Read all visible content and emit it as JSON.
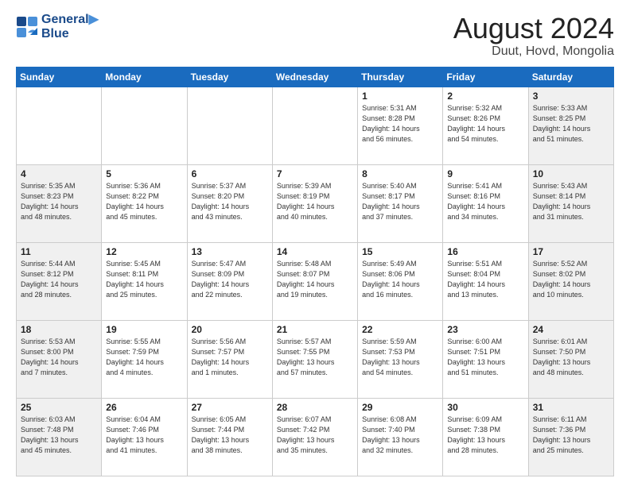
{
  "header": {
    "logo_line1": "General",
    "logo_line2": "Blue",
    "month": "August 2024",
    "location": "Duut, Hovd, Mongolia"
  },
  "weekdays": [
    "Sunday",
    "Monday",
    "Tuesday",
    "Wednesday",
    "Thursday",
    "Friday",
    "Saturday"
  ],
  "weeks": [
    [
      {
        "day": "",
        "info": ""
      },
      {
        "day": "",
        "info": ""
      },
      {
        "day": "",
        "info": ""
      },
      {
        "day": "",
        "info": ""
      },
      {
        "day": "1",
        "info": "Sunrise: 5:31 AM\nSunset: 8:28 PM\nDaylight: 14 hours\nand 56 minutes."
      },
      {
        "day": "2",
        "info": "Sunrise: 5:32 AM\nSunset: 8:26 PM\nDaylight: 14 hours\nand 54 minutes."
      },
      {
        "day": "3",
        "info": "Sunrise: 5:33 AM\nSunset: 8:25 PM\nDaylight: 14 hours\nand 51 minutes."
      }
    ],
    [
      {
        "day": "4",
        "info": "Sunrise: 5:35 AM\nSunset: 8:23 PM\nDaylight: 14 hours\nand 48 minutes."
      },
      {
        "day": "5",
        "info": "Sunrise: 5:36 AM\nSunset: 8:22 PM\nDaylight: 14 hours\nand 45 minutes."
      },
      {
        "day": "6",
        "info": "Sunrise: 5:37 AM\nSunset: 8:20 PM\nDaylight: 14 hours\nand 43 minutes."
      },
      {
        "day": "7",
        "info": "Sunrise: 5:39 AM\nSunset: 8:19 PM\nDaylight: 14 hours\nand 40 minutes."
      },
      {
        "day": "8",
        "info": "Sunrise: 5:40 AM\nSunset: 8:17 PM\nDaylight: 14 hours\nand 37 minutes."
      },
      {
        "day": "9",
        "info": "Sunrise: 5:41 AM\nSunset: 8:16 PM\nDaylight: 14 hours\nand 34 minutes."
      },
      {
        "day": "10",
        "info": "Sunrise: 5:43 AM\nSunset: 8:14 PM\nDaylight: 14 hours\nand 31 minutes."
      }
    ],
    [
      {
        "day": "11",
        "info": "Sunrise: 5:44 AM\nSunset: 8:12 PM\nDaylight: 14 hours\nand 28 minutes."
      },
      {
        "day": "12",
        "info": "Sunrise: 5:45 AM\nSunset: 8:11 PM\nDaylight: 14 hours\nand 25 minutes."
      },
      {
        "day": "13",
        "info": "Sunrise: 5:47 AM\nSunset: 8:09 PM\nDaylight: 14 hours\nand 22 minutes."
      },
      {
        "day": "14",
        "info": "Sunrise: 5:48 AM\nSunset: 8:07 PM\nDaylight: 14 hours\nand 19 minutes."
      },
      {
        "day": "15",
        "info": "Sunrise: 5:49 AM\nSunset: 8:06 PM\nDaylight: 14 hours\nand 16 minutes."
      },
      {
        "day": "16",
        "info": "Sunrise: 5:51 AM\nSunset: 8:04 PM\nDaylight: 14 hours\nand 13 minutes."
      },
      {
        "day": "17",
        "info": "Sunrise: 5:52 AM\nSunset: 8:02 PM\nDaylight: 14 hours\nand 10 minutes."
      }
    ],
    [
      {
        "day": "18",
        "info": "Sunrise: 5:53 AM\nSunset: 8:00 PM\nDaylight: 14 hours\nand 7 minutes."
      },
      {
        "day": "19",
        "info": "Sunrise: 5:55 AM\nSunset: 7:59 PM\nDaylight: 14 hours\nand 4 minutes."
      },
      {
        "day": "20",
        "info": "Sunrise: 5:56 AM\nSunset: 7:57 PM\nDaylight: 14 hours\nand 1 minutes."
      },
      {
        "day": "21",
        "info": "Sunrise: 5:57 AM\nSunset: 7:55 PM\nDaylight: 13 hours\nand 57 minutes."
      },
      {
        "day": "22",
        "info": "Sunrise: 5:59 AM\nSunset: 7:53 PM\nDaylight: 13 hours\nand 54 minutes."
      },
      {
        "day": "23",
        "info": "Sunrise: 6:00 AM\nSunset: 7:51 PM\nDaylight: 13 hours\nand 51 minutes."
      },
      {
        "day": "24",
        "info": "Sunrise: 6:01 AM\nSunset: 7:50 PM\nDaylight: 13 hours\nand 48 minutes."
      }
    ],
    [
      {
        "day": "25",
        "info": "Sunrise: 6:03 AM\nSunset: 7:48 PM\nDaylight: 13 hours\nand 45 minutes."
      },
      {
        "day": "26",
        "info": "Sunrise: 6:04 AM\nSunset: 7:46 PM\nDaylight: 13 hours\nand 41 minutes."
      },
      {
        "day": "27",
        "info": "Sunrise: 6:05 AM\nSunset: 7:44 PM\nDaylight: 13 hours\nand 38 minutes."
      },
      {
        "day": "28",
        "info": "Sunrise: 6:07 AM\nSunset: 7:42 PM\nDaylight: 13 hours\nand 35 minutes."
      },
      {
        "day": "29",
        "info": "Sunrise: 6:08 AM\nSunset: 7:40 PM\nDaylight: 13 hours\nand 32 minutes."
      },
      {
        "day": "30",
        "info": "Sunrise: 6:09 AM\nSunset: 7:38 PM\nDaylight: 13 hours\nand 28 minutes."
      },
      {
        "day": "31",
        "info": "Sunrise: 6:11 AM\nSunset: 7:36 PM\nDaylight: 13 hours\nand 25 minutes."
      }
    ]
  ]
}
